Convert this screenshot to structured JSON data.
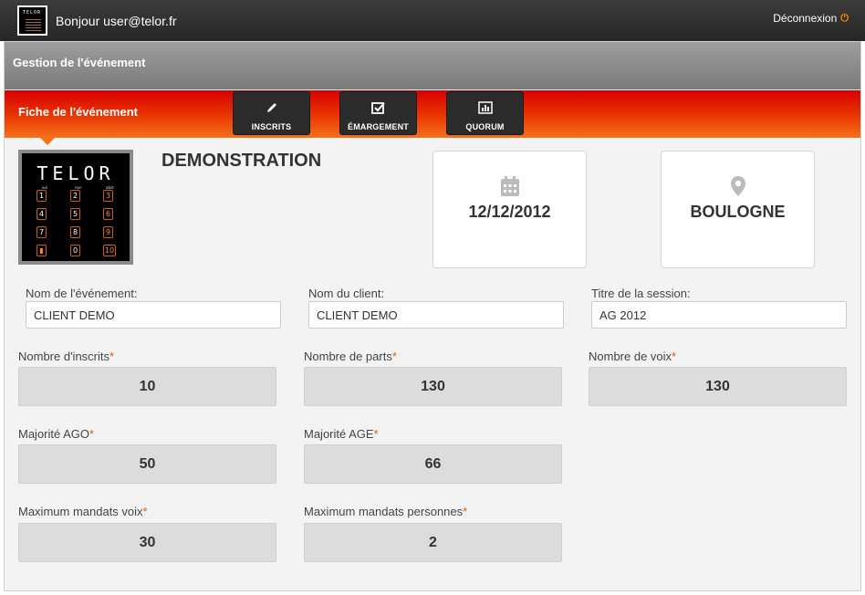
{
  "topbar": {
    "logo_text": "TELOR",
    "greeting": "Bonjour user@telor.fr",
    "logout_label": "Déconnexion"
  },
  "section": {
    "title": "Gestion de l'événement"
  },
  "band": {
    "title": "Fiche de l'événement",
    "tabs": [
      {
        "label": "INSCRITS",
        "icon": "pencil-icon"
      },
      {
        "label": "ÉMARGEMENT",
        "icon": "checkbox-icon"
      },
      {
        "label": "QUORUM",
        "icon": "bar-chart-icon"
      }
    ]
  },
  "event": {
    "logo_text": "TELOR",
    "keypad": {
      "headers": [
        "oui",
        "non",
        "abst"
      ],
      "keys": [
        "1",
        "2",
        "3",
        "4",
        "5",
        "6",
        "7",
        "8",
        "9",
        "0",
        "10"
      ]
    },
    "name": "DEMONSTRATION",
    "date": "12/12/2012",
    "location": "BOULOGNE"
  },
  "fields": {
    "event_name": {
      "label": "Nom de l'événement:",
      "value": "CLIENT DEMO"
    },
    "client_name": {
      "label": "Nom du client:",
      "value": "CLIENT DEMO"
    },
    "session_title": {
      "label": "Titre de la session:",
      "value": "AG 2012"
    },
    "nb_inscrits": {
      "label": "Nombre d'inscrits",
      "value": "10"
    },
    "nb_parts": {
      "label": "Nombre de parts",
      "value": "130"
    },
    "nb_voix": {
      "label": "Nombre de voix",
      "value": "130"
    },
    "majorite_ago": {
      "label": "Majorité AGO",
      "value": "50"
    },
    "majorite_age": {
      "label": "Majorité AGE",
      "value": "66"
    },
    "max_mandats_voix": {
      "label": "Maximum mandats voix",
      "value": "30"
    },
    "max_mandats_personnes": {
      "label": "Maximum mandats personnes",
      "value": "2"
    },
    "required_mark": "*"
  },
  "colors": {
    "accent": "#e83200",
    "required": "#e85a00",
    "logout_icon": "#ff8a00"
  }
}
